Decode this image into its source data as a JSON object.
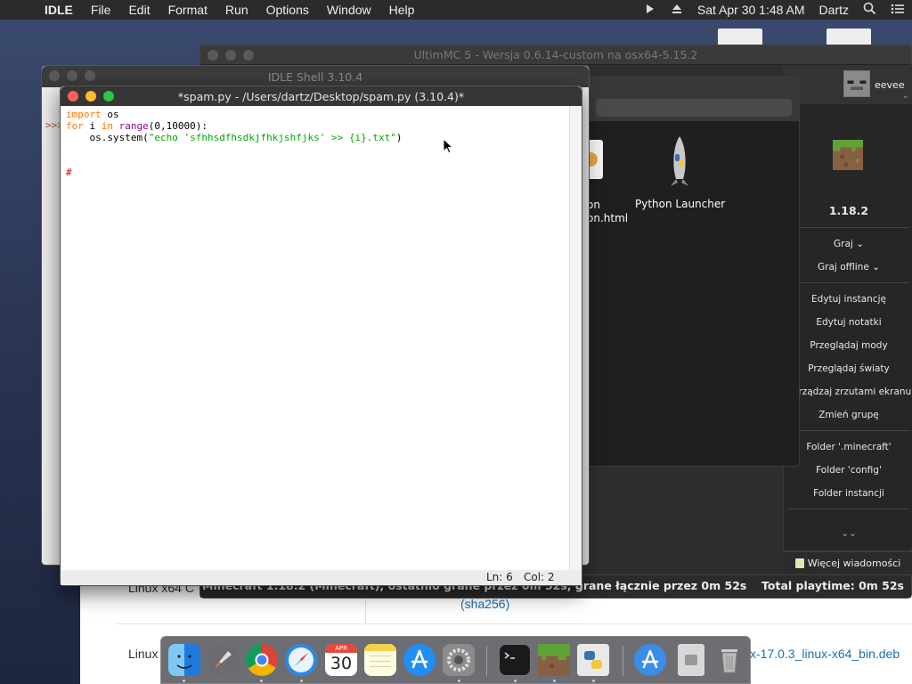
{
  "menubar": {
    "app": "IDLE",
    "items": [
      "File",
      "Edit",
      "Format",
      "Run",
      "Options",
      "Window",
      "Help"
    ],
    "datetime": "Sat Apr 30  1:48 AM",
    "user": "Dartz"
  },
  "browser": {
    "row1_left": "Linux x64 C",
    "row1_link": "(sha256)",
    "row2_left": "Linux",
    "row2_right": "x-17.0.3_linux-x64_bin.deb"
  },
  "multimc": {
    "title": "UltimMC 5 - Wersja 0.6.14-custom na osx64-5.15.2",
    "account": "eevee",
    "instance_version": "1.18.2",
    "buttons": [
      "Graj",
      "Graj offline",
      "Edytuj instancję",
      "Edytuj notatki",
      "Przeglądaj mody",
      "Przeglądaj światy",
      "Zarządzaj zrzutami ekranu",
      "Zmień grupę",
      "Folder '.minecraft'",
      "Folder 'config'",
      "Folder instancji"
    ],
    "status_left": "Minecraft 1.18.2 (Minecraft), ostatnio grane przez 0m 52s, grane łącznie przez 0m 52s",
    "status_right": "Total playtime: 0m 52s",
    "news": "Więcej wiadomości"
  },
  "finder": {
    "item1_line1": "on",
    "item1_line2": "on.html",
    "item2": "Python Launcher"
  },
  "shell": {
    "title": "IDLE Shell 3.10.4",
    "prompt": ">>>"
  },
  "editor": {
    "title": "*spam.py - /Users/dartz/Desktop/spam.py (3.10.4)*",
    "code": {
      "l1_kw": "import",
      "l1_rest": " os",
      "l2_kw": "for",
      "l2_a": " i ",
      "l2_in": "in",
      "l2_b": " ",
      "l2_bi": "range",
      "l2_c": "(0,10000):",
      "l3_a": "    os.system(",
      "l3_str": "\"echo 'sfhhsdfhsdkjfhkjshfjks' >> {i}.txt\"",
      "l3_b": ")",
      "l6_comment": "#"
    },
    "status": {
      "ln": "Ln: 6",
      "col": "Col: 2"
    }
  },
  "dock": {
    "calendar_month": "APR",
    "calendar_day": "30"
  }
}
